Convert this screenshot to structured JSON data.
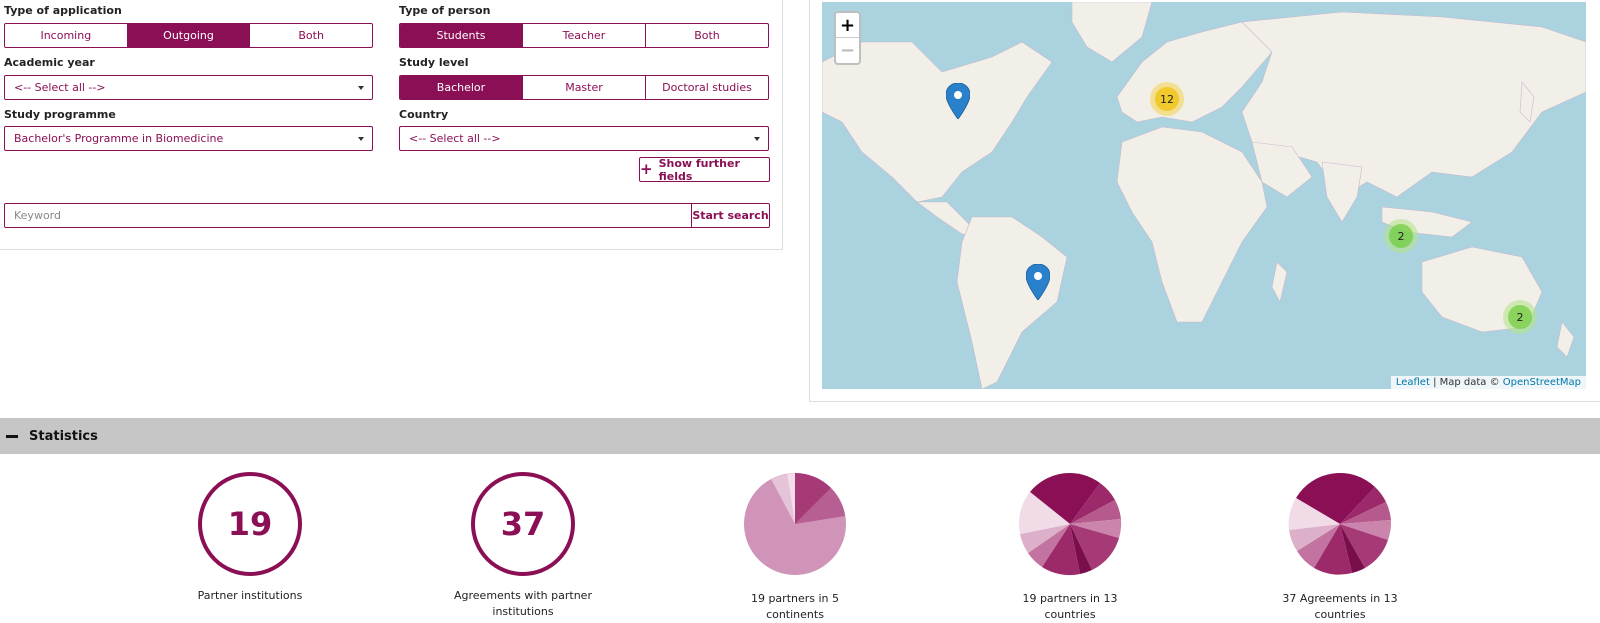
{
  "filters": {
    "type_of_application": {
      "label": "Type of application",
      "options": [
        "Incoming",
        "Outgoing",
        "Both"
      ],
      "active": "Outgoing"
    },
    "type_of_person": {
      "label": "Type of person",
      "options": [
        "Students",
        "Teacher",
        "Both"
      ],
      "active": "Students"
    },
    "academic_year": {
      "label": "Academic year",
      "value": "<-- Select all -->"
    },
    "study_level": {
      "label": "Study level",
      "options": [
        "Bachelor",
        "Master",
        "Doctoral studies"
      ],
      "active": "Bachelor"
    },
    "study_programme": {
      "label": "Study programme",
      "value": "Bachelor's Programme in Biomedicine"
    },
    "country": {
      "label": "Country",
      "value": "<-- Select all -->"
    },
    "further_fields_label": "Show further fields",
    "keyword_placeholder": "Keyword",
    "search_label": "Start search"
  },
  "map": {
    "zoom_in": "+",
    "zoom_out": "−",
    "attribution_leaflet": "Leaflet",
    "attribution_text": "| Map data ©",
    "attribution_osm": "OpenStreetMap",
    "clusters": [
      {
        "count": "12",
        "color": "#f1d357"
      },
      {
        "count": "2",
        "color": "#b5e28c"
      },
      {
        "count": "2",
        "color": "#b5e28c"
      }
    ],
    "marker_color": "#2a81cb"
  },
  "statistics": {
    "title": "Statistics",
    "partner_institutions": {
      "value": "19",
      "caption": "Partner institutions"
    },
    "agreements": {
      "value": "37",
      "caption": "Agreements with partner institutions"
    },
    "partners_continents": {
      "line1": "19 partners in 5",
      "line2": "continents"
    },
    "partners_countries": {
      "line1": "19 partners in 13",
      "line2": "countries"
    },
    "agreements_countries": {
      "line1": "37 Agreements in 13",
      "line2": "countries"
    }
  },
  "colors": {
    "accent": "#8b0f55",
    "stats_bar": "#c6c6c6",
    "water": "#aad3df",
    "land": "#f2efe9"
  }
}
